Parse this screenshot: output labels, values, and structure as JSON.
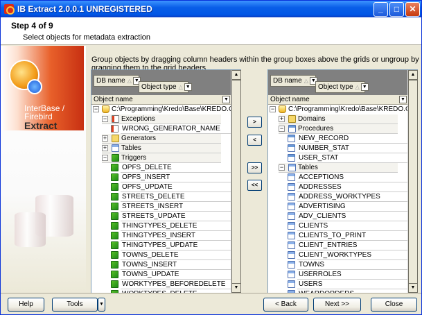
{
  "window": {
    "title": "IB Extract 2.0.0.1 UNREGISTERED"
  },
  "header": {
    "step": "Step 4 of 9",
    "subtitle": "Select objects for metadata extraction"
  },
  "brand": {
    "line1": "InterBase /",
    "line2": "Firebird",
    "line3": "Extract"
  },
  "hint": "Group objects by dragging column headers within the group boxes above the grids or ungroup by gragging them to the grid headers",
  "left": {
    "group_by": [
      "DB name",
      "Object type"
    ],
    "column": "Object name",
    "db": "C:\\Programming\\Kredo\\Base\\KREDO.GDB",
    "items": [
      {
        "kind": "group",
        "label": "Exceptions",
        "expanded": true,
        "icon": "exception-icon"
      },
      {
        "kind": "leaf",
        "label": "WRONG_GENERATOR_NAME",
        "icon": "exception-icon"
      },
      {
        "kind": "group",
        "label": "Generators",
        "expanded": false,
        "icon": "generator-icon"
      },
      {
        "kind": "group",
        "label": "Tables",
        "expanded": false,
        "icon": "table-icon"
      },
      {
        "kind": "group",
        "label": "Triggers",
        "expanded": true,
        "icon": "trigger-icon"
      },
      {
        "kind": "leaf",
        "label": "OPFS_DELETE",
        "icon": "trigger-icon"
      },
      {
        "kind": "leaf",
        "label": "OPFS_INSERT",
        "icon": "trigger-icon"
      },
      {
        "kind": "leaf",
        "label": "OPFS_UPDATE",
        "icon": "trigger-icon"
      },
      {
        "kind": "leaf",
        "label": "STREETS_DELETE",
        "icon": "trigger-icon"
      },
      {
        "kind": "leaf",
        "label": "STREETS_INSERT",
        "icon": "trigger-icon"
      },
      {
        "kind": "leaf",
        "label": "STREETS_UPDATE",
        "icon": "trigger-icon"
      },
      {
        "kind": "leaf",
        "label": "THINGTYPES_DELETE",
        "icon": "trigger-icon"
      },
      {
        "kind": "leaf",
        "label": "THINGTYPES_INSERT",
        "icon": "trigger-icon"
      },
      {
        "kind": "leaf",
        "label": "THINGTYPES_UPDATE",
        "icon": "trigger-icon"
      },
      {
        "kind": "leaf",
        "label": "TOWNS_DELETE",
        "icon": "trigger-icon"
      },
      {
        "kind": "leaf",
        "label": "TOWNS_INSERT",
        "icon": "trigger-icon"
      },
      {
        "kind": "leaf",
        "label": "TOWNS_UPDATE",
        "icon": "trigger-icon"
      },
      {
        "kind": "leaf",
        "label": "WORKTYPES_BEFOREDELETE",
        "icon": "trigger-icon"
      },
      {
        "kind": "leaf",
        "label": "WORKTYPES_DELETE",
        "icon": "trigger-icon"
      }
    ]
  },
  "right": {
    "group_by": [
      "DB name",
      "Object type"
    ],
    "column": "Object name",
    "db": "C:\\Programming\\Kredo\\Base\\KREDO.GDB",
    "items": [
      {
        "kind": "group",
        "label": "Domains",
        "expanded": false,
        "icon": "domain-icon"
      },
      {
        "kind": "group",
        "label": "Procedures",
        "expanded": true,
        "icon": "procedure-icon"
      },
      {
        "kind": "leaf",
        "label": "NEW_RECORD",
        "icon": "procedure-icon"
      },
      {
        "kind": "leaf",
        "label": "NUMBER_STAT",
        "icon": "procedure-icon"
      },
      {
        "kind": "leaf",
        "label": "USER_STAT",
        "icon": "procedure-icon"
      },
      {
        "kind": "group",
        "label": "Tables",
        "expanded": true,
        "icon": "table-icon"
      },
      {
        "kind": "leaf",
        "label": "ACCEPTIONS",
        "icon": "table-icon"
      },
      {
        "kind": "leaf",
        "label": "ADDRESSES",
        "icon": "table-icon"
      },
      {
        "kind": "leaf",
        "label": "ADDRESS_WORKTYPES",
        "icon": "table-icon"
      },
      {
        "kind": "leaf",
        "label": "ADVERTISING",
        "icon": "table-icon"
      },
      {
        "kind": "leaf",
        "label": "ADV_CLIENTS",
        "icon": "table-icon"
      },
      {
        "kind": "leaf",
        "label": "CLIENTS",
        "icon": "table-icon"
      },
      {
        "kind": "leaf",
        "label": "CLIENTS_TO_PRINT",
        "icon": "table-icon"
      },
      {
        "kind": "leaf",
        "label": "CLIENT_ENTRIES",
        "icon": "table-icon"
      },
      {
        "kind": "leaf",
        "label": "CLIENT_WORKTYPES",
        "icon": "table-icon"
      },
      {
        "kind": "leaf",
        "label": "TOWNS",
        "icon": "table-icon"
      },
      {
        "kind": "leaf",
        "label": "USERROLES",
        "icon": "table-icon"
      },
      {
        "kind": "leaf",
        "label": "USERS",
        "icon": "table-icon"
      },
      {
        "kind": "leaf",
        "label": "WEARDORDERS",
        "icon": "table-icon"
      }
    ]
  },
  "move_buttons": [
    ">",
    "<",
    ">>",
    "<<"
  ],
  "footer": {
    "help": "Help",
    "tools": "Tools",
    "back": "< Back",
    "next": "Next >>",
    "close": "Close"
  }
}
